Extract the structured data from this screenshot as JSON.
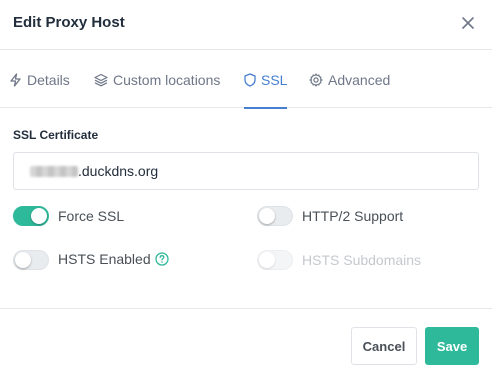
{
  "modal": {
    "title": "Edit Proxy Host"
  },
  "tabs": [
    {
      "label": "Details",
      "icon": "lightning-icon",
      "active": false
    },
    {
      "label": "Custom locations",
      "icon": "layers-icon",
      "active": false
    },
    {
      "label": "SSL",
      "icon": "shield-icon",
      "active": true
    },
    {
      "label": "Advanced",
      "icon": "gear-icon",
      "active": false
    }
  ],
  "ssl": {
    "certificate_label": "SSL Certificate",
    "certificate_value": ".duckdns.org",
    "options": {
      "force_ssl": {
        "label": "Force SSL",
        "checked": true,
        "disabled": false
      },
      "http2": {
        "label": "HTTP/2 Support",
        "checked": false,
        "disabled": false
      },
      "hsts": {
        "label": "HSTS Enabled",
        "checked": false,
        "disabled": false
      },
      "hsts_subdomains": {
        "label": "HSTS Subdomains",
        "checked": false,
        "disabled": true
      }
    }
  },
  "footer": {
    "cancel_label": "Cancel",
    "save_label": "Save"
  },
  "colors": {
    "accent": "#2fb99b",
    "active_tab": "#467fcf",
    "help_icon": "#2fb99b"
  }
}
